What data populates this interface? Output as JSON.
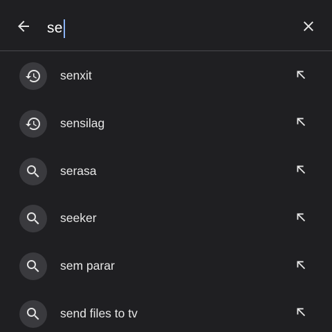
{
  "search": {
    "query": "se",
    "back_icon": "arrow-back-icon",
    "clear_icon": "close-icon"
  },
  "suggestions": [
    {
      "label": "senxit",
      "type": "history",
      "icon": "history-icon"
    },
    {
      "label": "sensilag",
      "type": "history",
      "icon": "history-icon"
    },
    {
      "label": "serasa",
      "type": "search",
      "icon": "search-icon"
    },
    {
      "label": "seeker",
      "type": "search",
      "icon": "search-icon"
    },
    {
      "label": "sem parar",
      "type": "search",
      "icon": "search-icon"
    },
    {
      "label": "send files to tv",
      "type": "search",
      "icon": "search-icon"
    }
  ],
  "fill_icon": "arrow-up-left-icon",
  "colors": {
    "background": "#1f1f22",
    "icon_bubble": "#3a3a3e",
    "caret": "#8ab4f8",
    "divider": "#4a4a4e"
  }
}
